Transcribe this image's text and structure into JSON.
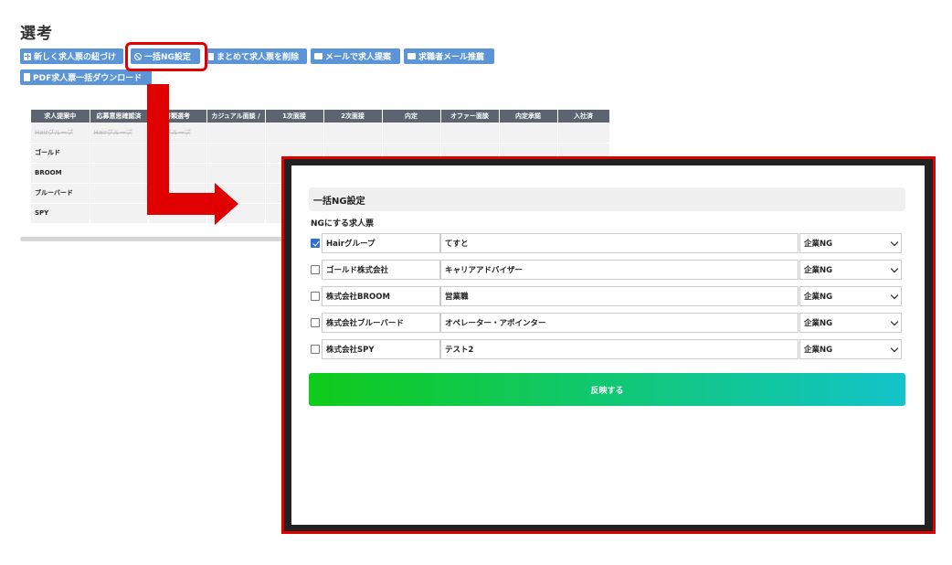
{
  "page": {
    "title": "選考"
  },
  "toolbar": {
    "link_new_label": "新しく求人票の紐づけ",
    "bulk_ng_label": "一括NG設定",
    "bulk_delete_label": "まとめて求人票を削除",
    "mail_propose_label": "メールで求人提案",
    "mail_recommend_label": "求職者メール推薦",
    "pdf_download_label": "PDF求人票一括ダウンロード"
  },
  "pipeline": {
    "columns": [
      "求人提案中",
      "応募意思確認済",
      "書類選考",
      "カジュアル面談 /",
      "1次面接",
      "2次面接",
      "内定",
      "オファー面談",
      "内定承諾",
      "入社済"
    ],
    "rows": [
      {
        "name": "Hairグループ",
        "c2": "Hairグループ",
        "c3": "Hairグループ"
      },
      {
        "name": "ゴールド"
      },
      {
        "name": "BROOM"
      },
      {
        "name": "ブルーバード"
      },
      {
        "name": "SPY"
      }
    ]
  },
  "modal": {
    "title": "一括NG設定",
    "subtitle": "NGにする求人票",
    "rows": [
      {
        "checked": true,
        "company": "Hairグループ",
        "job": "てすと",
        "select": "企業NG"
      },
      {
        "checked": false,
        "company": "ゴールド株式会社",
        "job": "キャリアアドバイザー",
        "select": "企業NG"
      },
      {
        "checked": false,
        "company": "株式会社BROOM",
        "job": "営業職",
        "select": "企業NG"
      },
      {
        "checked": false,
        "company": "株式会社ブルーバード",
        "job": "オペレーター・アポインター",
        "select": "企業NG"
      },
      {
        "checked": false,
        "company": "株式会社SPY",
        "job": "テスト2",
        "select": "企業NG"
      }
    ],
    "submit_label": "反映する"
  },
  "colors": {
    "button_blue": "#5b95d8",
    "highlight_red": "#e00000",
    "gradient_start": "#0fcb1a",
    "gradient_end": "#12c4ca"
  }
}
